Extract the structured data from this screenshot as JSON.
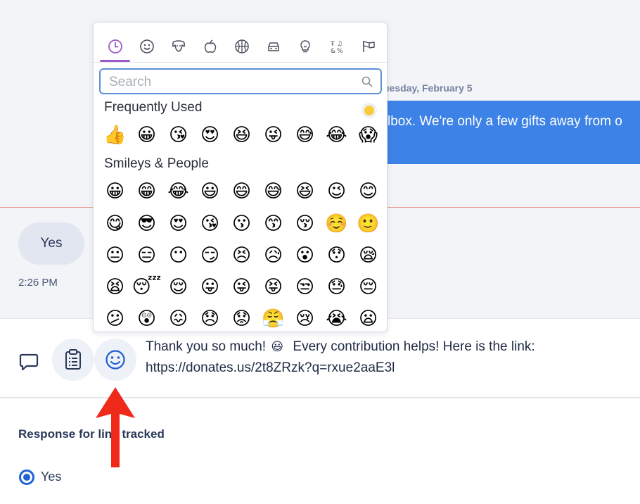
{
  "conversation": {
    "date_label": "uesday, February 5",
    "incoming_partial_text": "lbox. We're only a few gifts away from o",
    "reply_text": "Yes",
    "reply_time": "2:26 PM"
  },
  "composer": {
    "message_part1": "Thank you so much!",
    "inline_emoji": "😃",
    "message_part2": "Every contribution helps! Here is the link:",
    "message_link": "https://donates.us/2t8ZRzk?q=rxue2aaE3l"
  },
  "response": {
    "title": "Response for link tracked",
    "option_yes": "Yes"
  },
  "emoji_picker": {
    "categories": [
      "recent-icon",
      "smileys-icon",
      "animals-icon",
      "food-icon",
      "activity-icon",
      "travel-icon",
      "objects-icon",
      "symbols-icon",
      "flags-icon"
    ],
    "active_category": "recent-icon",
    "search_placeholder": "Search",
    "sections": {
      "frequent_title": "Frequently Used",
      "smileys_title": "Smileys & People"
    },
    "frequent": [
      "👍",
      "😀",
      "😘",
      "😍",
      "😆",
      "😜",
      "😅",
      "😂",
      "😱"
    ],
    "smileys": [
      [
        "😀",
        "😁",
        "😂",
        "😃",
        "😄",
        "😅",
        "😆",
        "😉",
        "😊"
      ],
      [
        "😋",
        "😎",
        "😍",
        "😘",
        "😗",
        "😙",
        "😚",
        "☺️",
        "🙂"
      ],
      [
        "😐",
        "😑",
        "😶",
        "😏",
        "😣",
        "😥",
        "😮",
        "😯",
        "😪"
      ],
      [
        "😫",
        "😴",
        "😌",
        "😛",
        "😜",
        "😝",
        "😒",
        "😓",
        "😔"
      ],
      [
        "😕",
        "😲",
        "😖",
        "😞",
        "😟",
        "😤",
        "😢",
        "😭",
        "😦"
      ]
    ],
    "skin_tone_color": "#fbcb3b"
  },
  "colors": {
    "accent_blue": "#3d82e6",
    "radio_blue": "#1f63d6",
    "active_tab": "#9b59c8",
    "annotation_arrow": "#f02a1a",
    "divider_red": "#ef8a80"
  }
}
